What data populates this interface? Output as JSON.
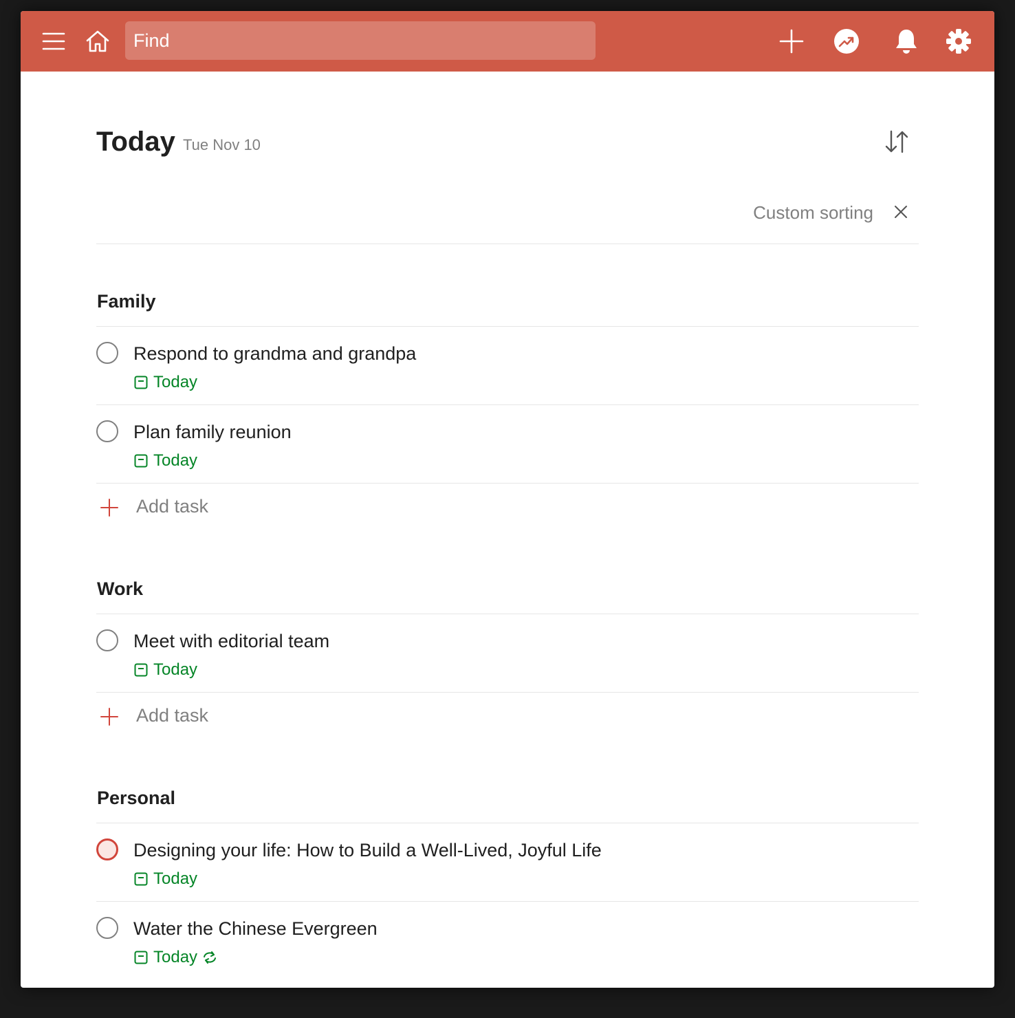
{
  "topbar": {
    "search_placeholder": "Find",
    "menu_icon": "hamburger-menu-icon",
    "home_icon": "home-icon",
    "add_icon": "plus-icon",
    "productivity_icon": "trend-up-icon",
    "notifications_icon": "bell-icon",
    "settings_icon": "gear-icon",
    "color": "#cf5a47"
  },
  "header": {
    "title": "Today",
    "date": "Tue Nov 10"
  },
  "sorting": {
    "label": "Custom sorting"
  },
  "sections": [
    {
      "name": "Family",
      "tasks": [
        {
          "title": "Respond to grandma and grandpa",
          "due": "Today",
          "priority": "none",
          "recurring": false
        },
        {
          "title": "Plan family reunion",
          "due": "Today",
          "priority": "none",
          "recurring": false
        }
      ],
      "add_label": "Add task"
    },
    {
      "name": "Work",
      "tasks": [
        {
          "title": "Meet with editorial team",
          "due": "Today",
          "priority": "none",
          "recurring": false
        }
      ],
      "add_label": "Add task"
    },
    {
      "name": "Personal",
      "tasks": [
        {
          "title": "Designing your life: How to Build a Well-Lived, Joyful Life",
          "due": "Today",
          "priority": "p1",
          "recurring": false
        },
        {
          "title": "Water the Chinese Evergreen",
          "due": "Today",
          "priority": "none",
          "recurring": true
        }
      ]
    }
  ],
  "colors": {
    "accent": "#cf5a47",
    "due_today": "#058527",
    "priority_1": "#d1453b"
  }
}
